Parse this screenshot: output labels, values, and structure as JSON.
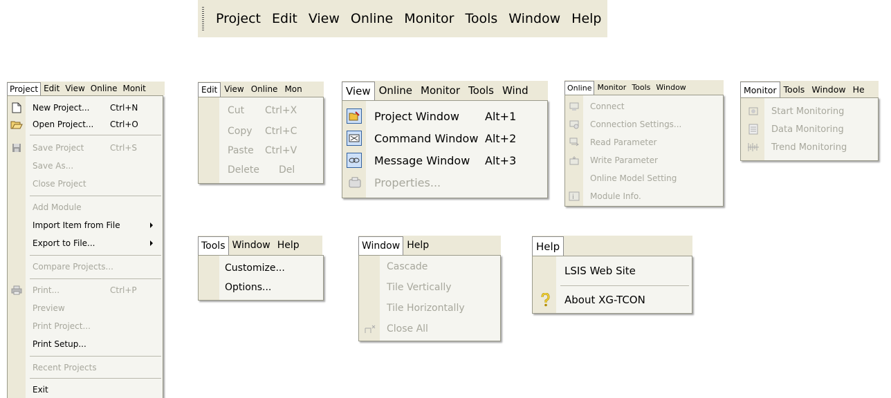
{
  "top_menubar": {
    "items": [
      "Project",
      "Edit",
      "View",
      "Online",
      "Monitor",
      "Tools",
      "Window",
      "Help"
    ]
  },
  "project_menu": {
    "bar": [
      "Project",
      "Edit",
      "View",
      "Online",
      "Monit"
    ],
    "items": [
      {
        "label": "New Project...",
        "shortcut": "Ctrl+N"
      },
      {
        "label": "Open Project...",
        "shortcut": "Ctrl+O"
      },
      {
        "label": "Save Project",
        "shortcut": "Ctrl+S"
      },
      {
        "label": "Save As..."
      },
      {
        "label": "Close Project"
      },
      {
        "label": "Add Module"
      },
      {
        "label": "Import Item from File"
      },
      {
        "label": "Export to File..."
      },
      {
        "label": "Compare Projects..."
      },
      {
        "label": "Print...",
        "shortcut": "Ctrl+P"
      },
      {
        "label": "Preview"
      },
      {
        "label": "Print Project..."
      },
      {
        "label": "Print Setup..."
      },
      {
        "label": "Recent Projects"
      },
      {
        "label": "Exit"
      }
    ]
  },
  "edit_menu": {
    "bar": [
      "Edit",
      "View",
      "Online",
      "Mon"
    ],
    "items": [
      {
        "label": "Cut",
        "shortcut": "Ctrl+X"
      },
      {
        "label": "Copy",
        "shortcut": "Ctrl+C"
      },
      {
        "label": "Paste",
        "shortcut": "Ctrl+V"
      },
      {
        "label": "Delete",
        "shortcut": "Del"
      }
    ]
  },
  "view_menu": {
    "bar": [
      "View",
      "Online",
      "Monitor",
      "Tools",
      "Wind"
    ],
    "items": [
      {
        "label": "Project Window",
        "shortcut": "Alt+1"
      },
      {
        "label": "Command Window",
        "shortcut": "Alt+2"
      },
      {
        "label": "Message Window",
        "shortcut": "Alt+3"
      },
      {
        "label": "Properties..."
      }
    ]
  },
  "online_menu": {
    "bar": [
      "Online",
      "Monitor",
      "Tools",
      "Window"
    ],
    "items": [
      {
        "label": "Connect"
      },
      {
        "label": "Connection Settings..."
      },
      {
        "label": "Read Parameter"
      },
      {
        "label": "Write Parameter"
      },
      {
        "label": "Online Model Setting"
      },
      {
        "label": "Module Info."
      }
    ]
  },
  "monitor_menu": {
    "bar": [
      "Monitor",
      "Tools",
      "Window",
      "He"
    ],
    "items": [
      {
        "label": "Start Monitoring"
      },
      {
        "label": "Data Monitoring"
      },
      {
        "label": "Trend Monitoring"
      }
    ]
  },
  "tools_menu": {
    "bar": [
      "Tools",
      "Window",
      "Help"
    ],
    "items": [
      {
        "label": "Customize..."
      },
      {
        "label": "Options..."
      }
    ]
  },
  "window_menu": {
    "bar": [
      "Window",
      "Help"
    ],
    "items": [
      {
        "label": "Cascade"
      },
      {
        "label": "Tile Vertically"
      },
      {
        "label": "Tile Horizontally"
      },
      {
        "label": "Close All"
      }
    ]
  },
  "help_menu": {
    "bar": [
      "Help"
    ],
    "items": [
      {
        "label": "LSIS Web Site"
      },
      {
        "label": "About XG-TCON"
      }
    ]
  },
  "icons": {
    "new": "new-document-icon",
    "open": "open-folder-icon",
    "save": "save-disk-icon",
    "print": "printer-icon",
    "help": "question-mark-icon"
  }
}
